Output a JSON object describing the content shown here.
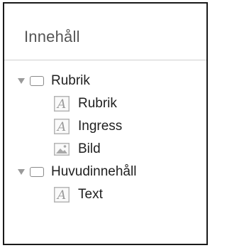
{
  "panel": {
    "title": "Innehåll"
  },
  "tree": {
    "groups": [
      {
        "label": "Rubrik",
        "items": [
          {
            "label": "Rubrik",
            "icon": "text-icon"
          },
          {
            "label": "Ingress",
            "icon": "text-icon"
          },
          {
            "label": "Bild",
            "icon": "image-icon"
          }
        ]
      },
      {
        "label": "Huvudinnehåll",
        "items": [
          {
            "label": "Text",
            "icon": "text-icon"
          }
        ]
      }
    ]
  },
  "colors": {
    "border": "#1a1a1a",
    "text": "#1f1f1f",
    "title": "#555555",
    "icon": "#8a8a8a"
  }
}
